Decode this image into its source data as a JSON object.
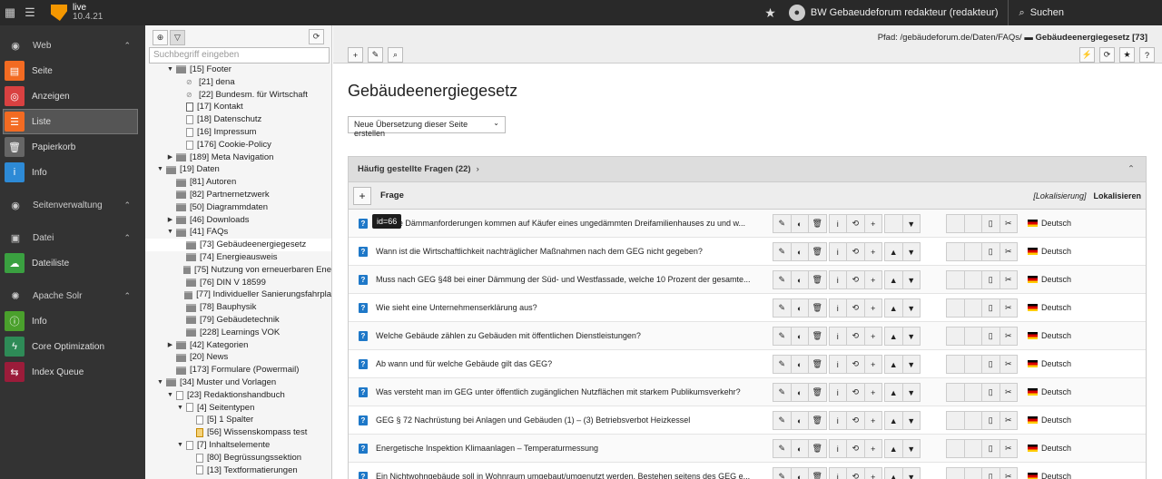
{
  "topbar": {
    "site_name": "live",
    "version": "10.4.21",
    "user": "BW Gebaeudeforum redakteur (redakteur)",
    "search_label": "Suchen"
  },
  "modules": [
    {
      "type": "group",
      "label": "Web",
      "icon": "globe-icon"
    },
    {
      "type": "item",
      "label": "Seite",
      "icon": "page-icon",
      "color": "#f36b22"
    },
    {
      "type": "item",
      "label": "Anzeigen",
      "icon": "eye-icon",
      "color": "#d94141"
    },
    {
      "type": "item",
      "label": "Liste",
      "icon": "list-icon",
      "color": "#f36b22",
      "active": true
    },
    {
      "type": "item",
      "label": "Papierkorb",
      "icon": "trash-icon",
      "color": "#666666"
    },
    {
      "type": "item",
      "label": "Info",
      "icon": "info-icon",
      "color": "#2d8ad6"
    },
    {
      "type": "group",
      "label": "Seitenverwaltung",
      "icon": "globe-icon"
    },
    {
      "type": "group",
      "label": "Datei",
      "icon": "image-icon"
    },
    {
      "type": "item",
      "label": "Dateiliste",
      "icon": "cloud-icon",
      "color": "#3aa040"
    },
    {
      "type": "group",
      "label": "Apache Solr",
      "icon": "solr-icon"
    },
    {
      "type": "item",
      "label": "Info",
      "icon": "info-circle-icon",
      "color": "#4aa02c"
    },
    {
      "type": "item",
      "label": "Core Optimization",
      "icon": "bolt-icon",
      "color": "#2e8b57"
    },
    {
      "type": "item",
      "label": "Index Queue",
      "icon": "queue-icon",
      "color": "#9b1c3a"
    }
  ],
  "tree": {
    "search_placeholder": "Suchbegriff eingeben",
    "nodes": [
      {
        "label": "[15] Footer",
        "level": 2,
        "toggle": "▼",
        "icon": "folder"
      },
      {
        "label": "[21] dena",
        "level": 3,
        "toggle": "",
        "icon": "link"
      },
      {
        "label": "[22] Bundesm. für Wirtschaft",
        "level": 3,
        "toggle": "",
        "icon": "link"
      },
      {
        "label": "[17] Kontakt",
        "level": 3,
        "toggle": "",
        "icon": "contact"
      },
      {
        "label": "[18] Datenschutz",
        "level": 3,
        "toggle": "",
        "icon": "page"
      },
      {
        "label": "[16] Impressum",
        "level": 3,
        "toggle": "",
        "icon": "page"
      },
      {
        "label": "[176] Cookie-Policy",
        "level": 3,
        "toggle": "",
        "icon": "page"
      },
      {
        "label": "[189] Meta Navigation",
        "level": 2,
        "toggle": "▶",
        "icon": "folder"
      },
      {
        "label": "[19] Daten",
        "level": 1,
        "toggle": "▼",
        "icon": "folder"
      },
      {
        "label": "[81] Autoren",
        "level": 2,
        "toggle": "",
        "icon": "folder"
      },
      {
        "label": "[82] Partnernetzwerk",
        "level": 2,
        "toggle": "",
        "icon": "folder"
      },
      {
        "label": "[50] Diagrammdaten",
        "level": 2,
        "toggle": "",
        "icon": "folder"
      },
      {
        "label": "[46] Downloads",
        "level": 2,
        "toggle": "▶",
        "icon": "folder"
      },
      {
        "label": "[41] FAQs",
        "level": 2,
        "toggle": "▼",
        "icon": "folder"
      },
      {
        "label": "[73] Gebäudeenergiegesetz",
        "level": 3,
        "toggle": "",
        "icon": "folder",
        "selected": true
      },
      {
        "label": "[74] Energieausweis",
        "level": 3,
        "toggle": "",
        "icon": "folder"
      },
      {
        "label": "[75] Nutzung von erneuerbaren Ene",
        "level": 3,
        "toggle": "",
        "icon": "folder"
      },
      {
        "label": "[76] DIN V 18599",
        "level": 3,
        "toggle": "",
        "icon": "folder"
      },
      {
        "label": "[77] Individueller Sanierungsfahrpla",
        "level": 3,
        "toggle": "",
        "icon": "folder"
      },
      {
        "label": "[78] Bauphysik",
        "level": 3,
        "toggle": "",
        "icon": "folder"
      },
      {
        "label": "[79] Gebäudetechnik",
        "level": 3,
        "toggle": "",
        "icon": "folder"
      },
      {
        "label": "[228] Learnings VOK",
        "level": 3,
        "toggle": "",
        "icon": "folder"
      },
      {
        "label": "[42] Kategorien",
        "level": 2,
        "toggle": "▶",
        "icon": "folder"
      },
      {
        "label": "[20] News",
        "level": 2,
        "toggle": "",
        "icon": "folder"
      },
      {
        "label": "[173] Formulare (Powermail)",
        "level": 2,
        "toggle": "",
        "icon": "folder"
      },
      {
        "label": "[34] Muster und Vorlagen",
        "level": 1,
        "toggle": "▼",
        "icon": "folder"
      },
      {
        "label": "[23] Redaktionshandbuch",
        "level": 2,
        "toggle": "▼",
        "icon": "page"
      },
      {
        "label": "[4] Seitentypen",
        "level": 3,
        "toggle": "▼",
        "icon": "page"
      },
      {
        "label": "[5] 1 Spalter",
        "level": 4,
        "toggle": "",
        "icon": "page"
      },
      {
        "label": "[56] Wissenskompass test",
        "level": 4,
        "toggle": "",
        "icon": "orange"
      },
      {
        "label": "[7] Inhaltselemente",
        "level": 3,
        "toggle": "▼",
        "icon": "page"
      },
      {
        "label": "[80] Begrüssungssektion",
        "level": 4,
        "toggle": "",
        "icon": "page"
      },
      {
        "label": "[13] Textformatierungen",
        "level": 4,
        "toggle": "",
        "icon": "page"
      }
    ]
  },
  "docheader": {
    "path_prefix": "Pfad: /gebäudeforum.de/Daten/FAQs/",
    "path_current": "Gebäudeenergiegesetz [73]"
  },
  "page": {
    "title": "Gebäudeenergiegesetz",
    "translation_select": "Neue Übersetzung dieser Seite erstellen"
  },
  "panel": {
    "title": "Häufig gestellte Fragen (22)",
    "col_frage": "Frage",
    "col_lokalisierung": "[Lokalisierung]",
    "col_lokalisieren": "Lokalisieren",
    "tooltip": "id=66",
    "language": "Deutsch",
    "rows": [
      "Welche Dämmanforderungen kommen auf Käufer eines ungedämmten Dreifamilienhauses zu und w...",
      "Wann ist die Wirtschaftlichkeit nachträglicher Maßnahmen nach dem GEG nicht gegeben?",
      "Muss nach GEG §48 bei einer Dämmung der Süd- und Westfassade, welche 10 Prozent der gesamte...",
      "Wie sieht eine Unternehmenserklärung aus?",
      "Welche Gebäude zählen zu Gebäuden mit öffentlichen Dienstleistungen?",
      "Ab wann und für welche Gebäude gilt das GEG?",
      "Was versteht man im GEG unter öffentlich zugänglichen Nutzflächen mit starkem Publikumsverkehr?",
      "GEG § 72 Nachrüstung bei Anlagen und Gebäuden (1) – (3) Betriebsverbot Heizkessel",
      "Energetische Inspektion Klimaanlagen – Temperaturmessung",
      "Ein Nichtwohngebäude soll in Wohnraum umgebaut/umgenutzt werden. Bestehen seitens des GEG e..."
    ]
  }
}
